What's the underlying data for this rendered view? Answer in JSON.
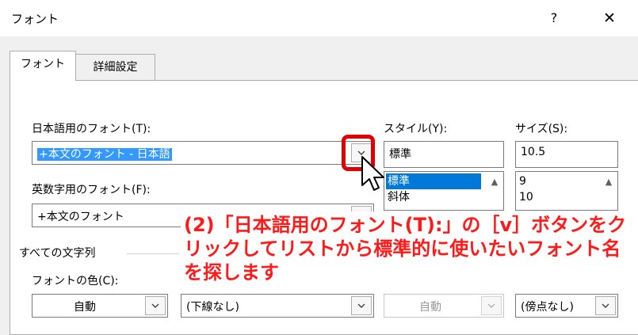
{
  "window": {
    "title": "フォント",
    "help_label": "?",
    "close_label": "✕"
  },
  "tabs": [
    {
      "label": "フォント",
      "active": true
    },
    {
      "label": "詳細設定",
      "active": false
    }
  ],
  "japanese_font": {
    "label": "日本語用のフォント(T):",
    "value": "+本文のフォント - 日本語"
  },
  "english_font": {
    "label": "英数字用のフォント(F):",
    "value": "+本文のフォント"
  },
  "style": {
    "label": "スタイル(Y):",
    "value": "標準",
    "options": [
      "標準",
      "斜体"
    ],
    "selected_index": 0
  },
  "size": {
    "label": "サイズ(S):",
    "value": "10.5",
    "options": [
      "9",
      "10"
    ]
  },
  "all_text": {
    "label": "すべての文字列"
  },
  "font_color": {
    "label": "フォントの色(C):",
    "value": "自動"
  },
  "underline": {
    "value": "(下線なし)"
  },
  "underline_color": {
    "value": "自動"
  },
  "emphasis": {
    "value": "(傍点なし)"
  },
  "annotation": {
    "text": "(2)「日本語用のフォント(T):」の［v］ボタンをクリックしてリストから標準的に使いたいフォント名を探します"
  },
  "colors": {
    "annotation": "#ff1a1a",
    "highlight_border": "#e00000",
    "selection": "#0078d7"
  }
}
